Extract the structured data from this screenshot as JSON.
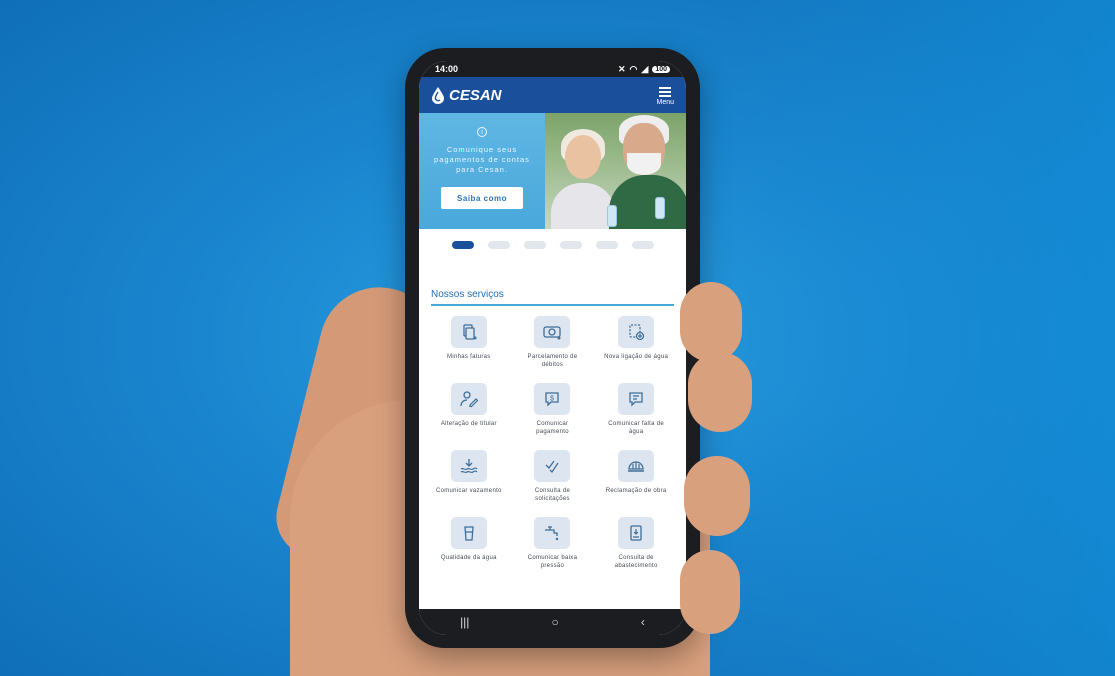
{
  "statusbar": {
    "time": "14:00",
    "battery": "100"
  },
  "app": {
    "logo_text": "CESAN",
    "menu_label": "Menu"
  },
  "banner": {
    "text": "Comunique seus pagamentos de contas para Cesan.",
    "button_label": "Saiba como",
    "active_slide": 1,
    "slide_count": 6
  },
  "services": {
    "title": "Nossos serviços",
    "items": [
      {
        "label": "Minhas faturas",
        "icon": "invoices-icon"
      },
      {
        "label": "Parcelamento de débitos",
        "icon": "installment-icon"
      },
      {
        "label": "Nova ligação de água",
        "icon": "new-connection-icon"
      },
      {
        "label": "Alteração de titular",
        "icon": "change-holder-icon"
      },
      {
        "label": "Comunicar pagamento",
        "icon": "payment-message-icon"
      },
      {
        "label": "Comunicar falta de água",
        "icon": "water-shortage-message-icon"
      },
      {
        "label": "Comunicar vazamento",
        "icon": "leak-icon"
      },
      {
        "label": "Consulta de solicitações",
        "icon": "check-requests-icon"
      },
      {
        "label": "Reclamação de obra",
        "icon": "construction-complaint-icon"
      },
      {
        "label": "Qualidade da água",
        "icon": "water-quality-icon"
      },
      {
        "label": "Comunicar baixa pressão",
        "icon": "low-pressure-icon"
      },
      {
        "label": "Consulta de abastecimento",
        "icon": "supply-check-icon"
      }
    ]
  },
  "colors": {
    "brand": "#1a4f9c",
    "accent": "#4aa8db",
    "background": "#1a86cf"
  }
}
